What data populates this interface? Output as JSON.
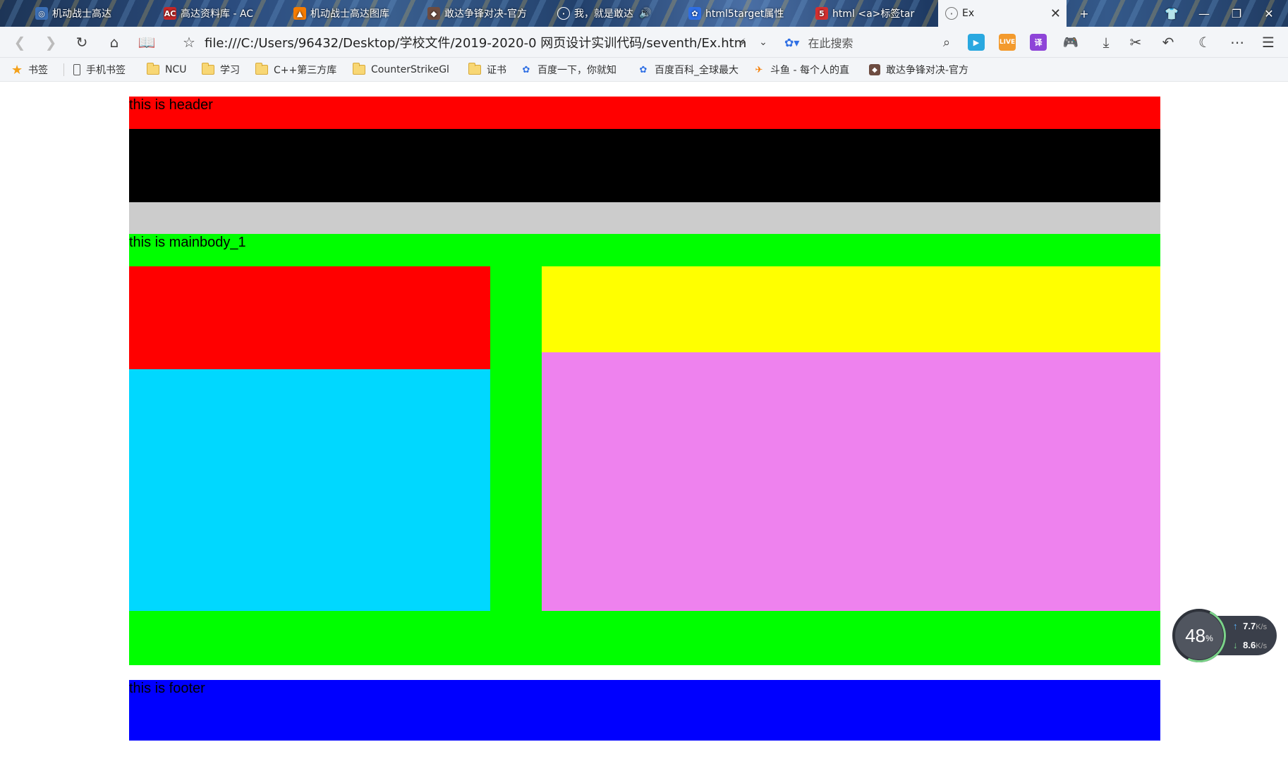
{
  "browser": {
    "tabs": [
      {
        "title": "机动战士高达",
        "icon": "gundam-icon",
        "color": "#3b6fb6"
      },
      {
        "title": "高达资料库 - AC",
        "icon": "ac-icon",
        "color": "#c62828"
      },
      {
        "title": "机动战士高达图库",
        "icon": "gundam-gallery-icon",
        "color": "#f57c00"
      },
      {
        "title": "敢达争锋对决-官方",
        "icon": "game-icon",
        "color": "#6d4c41"
      },
      {
        "title": "我，就是敢达",
        "icon": "globe-icon",
        "color": "#546e7a"
      },
      {
        "title": "html5target属性",
        "icon": "baidu-paw-icon",
        "color": "#2f6fe4"
      },
      {
        "title": "html <a>标签tar",
        "icon": "html5-icon",
        "color": "#d32f2f"
      },
      {
        "title": "Ex",
        "icon": "globe-icon",
        "color": "#888888"
      }
    ],
    "new_tab_label": "+",
    "address": "file:///C:/Users/96432/Desktop/学校文件/2019-2020-0 网页设计实训代码/seventh/Ex.htm",
    "search_placeholder": "在此搜索",
    "bookmarks": [
      {
        "label": "书签",
        "icon": "star-icon"
      },
      {
        "label": "手机书签",
        "icon": "phone-icon"
      },
      {
        "label": "NCU",
        "icon": "folder-icon"
      },
      {
        "label": "学习",
        "icon": "folder-icon"
      },
      {
        "label": "C++第三方库",
        "icon": "folder-icon"
      },
      {
        "label": "CounterStrikeGl",
        "icon": "folder-icon"
      },
      {
        "label": "证书",
        "icon": "folder-icon"
      },
      {
        "label": "百度一下，你就知",
        "icon": "baidu-paw-icon"
      },
      {
        "label": "百度百科_全球最大",
        "icon": "baidu-paw-icon"
      },
      {
        "label": "斗鱼 - 每个人的直",
        "icon": "douyu-icon"
      },
      {
        "label": "敢达争锋对决-官方",
        "icon": "game-icon"
      }
    ],
    "extensions": [
      {
        "name": "video-icon",
        "label": "▶",
        "color": "#29a8e0"
      },
      {
        "name": "live-icon",
        "label": "LIVE",
        "color": "#f39a2d"
      },
      {
        "name": "translate-icon",
        "label": "译",
        "color": "#8e44d8"
      },
      {
        "name": "gamepad-icon",
        "label": "🎮",
        "color": "#e8553a"
      }
    ]
  },
  "page": {
    "header_text": "this is header",
    "mainbody_text": "this is mainbody_1",
    "footer_text": "this is footer",
    "colors": {
      "header": "#ff0000",
      "nav": "#000000",
      "banner": "#cccccc",
      "mainbody": "#00ff00",
      "left_top": "#ff0000",
      "left_bottom": "#00d8ff",
      "right_top": "#ffff00",
      "right_bottom": "#ee82ee",
      "footer": "#0000ff"
    }
  },
  "netmon": {
    "percent": "48",
    "percent_unit": "%",
    "up": "7.7",
    "down": "8.6",
    "unit": "K/s"
  }
}
